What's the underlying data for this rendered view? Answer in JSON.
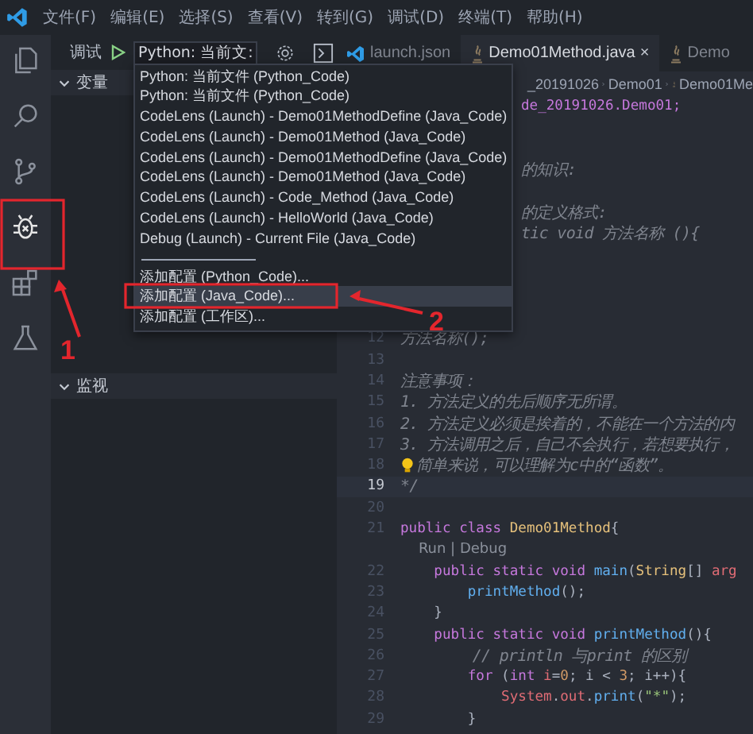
{
  "menu_bar": {
    "items": [
      "文件(F)",
      "编辑(E)",
      "选择(S)",
      "查看(V)",
      "转到(G)",
      "调试(D)",
      "终端(T)",
      "帮助(H)"
    ]
  },
  "activity_bar": {
    "items": [
      {
        "kind": "files",
        "selected": false
      },
      {
        "kind": "search",
        "selected": false
      },
      {
        "kind": "scm",
        "selected": false
      },
      {
        "kind": "debug",
        "selected": true
      },
      {
        "kind": "extensions",
        "selected": false
      },
      {
        "kind": "flask",
        "selected": false
      }
    ]
  },
  "sidebar": {
    "title": "调试",
    "config_select": "Python: 当前文:",
    "sections": [
      {
        "title": "变量",
        "expanded": true
      },
      {
        "title": "监视",
        "expanded": true
      }
    ]
  },
  "config_menu": {
    "items": [
      {
        "label": "Python: 当前文件 (Python_Code)",
        "selected": false
      },
      {
        "label": "Python: 当前文件 (Python_Code)",
        "selected": false
      },
      {
        "label": "CodeLens (Launch) - Demo01MethodDefine (Java_Code)",
        "selected": false
      },
      {
        "label": "CodeLens (Launch) - Demo01Method (Java_Code)",
        "selected": false
      },
      {
        "label": "CodeLens (Launch) - Demo01MethodDefine (Java_Code)",
        "selected": false
      },
      {
        "label": "CodeLens (Launch) - Demo01Method (Java_Code)",
        "selected": false
      },
      {
        "label": "CodeLens (Launch) - Code_Method (Java_Code)",
        "selected": false
      },
      {
        "label": "CodeLens (Launch) - HelloWorld (Java_Code)",
        "selected": false
      },
      {
        "label": "Debug (Launch) - Current File (Java_Code)",
        "selected": false
      }
    ],
    "actions": [
      {
        "label": "添加配置 (Python_Code)...",
        "selected": false
      },
      {
        "label": "添加配置 (Java_Code)...",
        "selected": true
      },
      {
        "label": "添加配置 (工作区)...",
        "selected": false
      }
    ]
  },
  "tabs": [
    {
      "label": "launch.json",
      "kind": "vscode",
      "selected": false
    },
    {
      "label": "Demo01Method.java",
      "kind": "java",
      "selected": true,
      "close": "×"
    },
    {
      "label": "Demo",
      "kind": "java",
      "selected": false
    }
  ],
  "breadcrumb": [
    "_20191026",
    "Demo01",
    "Demo01Me"
  ],
  "code": {
    "lines": [
      {
        "kind": "partial",
        "tokens": [
          {
            "text": "de_20191026.Demo01;",
            "kind": "package"
          }
        ]
      },
      {
        "kind": "covered"
      },
      {
        "kind": "covered"
      },
      {
        "kind": "partial",
        "tokens": [
          {
            "text": "的知识:",
            "kind": "comment"
          }
        ]
      },
      {
        "kind": "covered"
      },
      {
        "kind": "partial",
        "tokens": [
          {
            "text": "的定义格式:",
            "kind": "comment"
          }
        ]
      },
      {
        "kind": "partial",
        "tokens": [
          {
            "text": "tic void 方法名称 (){",
            "kind": "comment"
          }
        ]
      },
      {
        "kind": "covered"
      },
      {
        "kind": "covered"
      },
      {
        "kind": "covered"
      },
      {
        "kind": "covered"
      },
      {
        "kind": "code",
        "number": "12",
        "current": false,
        "tokens": [
          {
            "text": "方法名称();",
            "kind": "comment"
          }
        ]
      },
      {
        "kind": "code",
        "number": "13",
        "current": false
      },
      {
        "kind": "code",
        "number": "14",
        "current": false,
        "tokens": [
          {
            "text": "注意事项：",
            "kind": "comment"
          }
        ]
      },
      {
        "kind": "code",
        "number": "15",
        "current": false,
        "tokens": [
          {
            "text": "1. 方法定义的先后顺序无所谓。",
            "kind": "comment"
          }
        ]
      },
      {
        "kind": "code",
        "number": "16",
        "current": false,
        "tokens": [
          {
            "text": "2. 方法定义必须是挨着的，不能在一个方法的内",
            "kind": "comment"
          }
        ]
      },
      {
        "kind": "code",
        "number": "17",
        "current": false,
        "tokens": [
          {
            "text": "3. 方法调用之后，自己不会执行，若想要执行，",
            "kind": "comment"
          }
        ]
      },
      {
        "kind": "bulb",
        "number": "18",
        "current": false,
        "tokens": [
          {
            "text": "简单来说，可以理解为c中的“函数”。",
            "kind": "comment"
          }
        ]
      },
      {
        "kind": "code",
        "number": "19",
        "current": true,
        "tokens": [
          {
            "text": "*/",
            "kind": "comment"
          }
        ]
      },
      {
        "kind": "code",
        "number": "20",
        "current": false
      },
      {
        "kind": "code",
        "number": "21",
        "current": false,
        "tokens": [
          {
            "text": "public class ",
            "kind": "keyword"
          },
          {
            "text": "Demo01Method",
            "kind": "type"
          },
          {
            "text": "{",
            "kind": "plain"
          }
        ]
      },
      {
        "kind": "codelens",
        "tokens": [
          {
            "text": "    Run | Debug",
            "kind": "lens"
          }
        ]
      },
      {
        "kind": "code",
        "number": "22",
        "current": false,
        "tokens": [
          {
            "text": "    public static void ",
            "kind": "keyword"
          },
          {
            "text": "main",
            "kind": "func"
          },
          {
            "text": "(",
            "kind": "plain"
          },
          {
            "text": "String",
            "kind": "type"
          },
          {
            "text": "[] ",
            "kind": "plain"
          },
          {
            "text": "arg",
            "kind": "var"
          }
        ]
      },
      {
        "kind": "code",
        "number": "23",
        "current": false,
        "tokens": [
          {
            "text": "        printMethod",
            "kind": "func"
          },
          {
            "text": "();",
            "kind": "plain"
          }
        ]
      },
      {
        "kind": "code",
        "number": "24",
        "current": false,
        "tokens": [
          {
            "text": "    }",
            "kind": "plain"
          }
        ]
      },
      {
        "kind": "code",
        "number": "25",
        "current": false,
        "tokens": [
          {
            "text": "    public static void ",
            "kind": "keyword"
          },
          {
            "text": "printMethod",
            "kind": "func"
          },
          {
            "text": "(){",
            "kind": "plain"
          }
        ]
      },
      {
        "kind": "code",
        "number": "26",
        "current": false,
        "tokens": [
          {
            "text": "        // println 与print 的区别",
            "kind": "comment"
          }
        ]
      },
      {
        "kind": "code",
        "number": "27",
        "current": false,
        "tokens": [
          {
            "text": "        for",
            "kind": "keyword"
          },
          {
            "text": " (",
            "kind": "plain"
          },
          {
            "text": "int ",
            "kind": "keyword"
          },
          {
            "text": "i",
            "kind": "var"
          },
          {
            "text": "=",
            "kind": "plain"
          },
          {
            "text": "0",
            "kind": "number"
          },
          {
            "text": "; i < ",
            "kind": "plain"
          },
          {
            "text": "3",
            "kind": "number"
          },
          {
            "text": "; i++){",
            "kind": "plain"
          }
        ]
      },
      {
        "kind": "code",
        "number": "28",
        "current": false,
        "tokens": [
          {
            "text": "            System",
            "kind": "var"
          },
          {
            "text": ".",
            "kind": "plain"
          },
          {
            "text": "out",
            "kind": "var"
          },
          {
            "text": ".",
            "kind": "plain"
          },
          {
            "text": "print",
            "kind": "func"
          },
          {
            "text": "(",
            "kind": "plain"
          },
          {
            "text": "\"*\"",
            "kind": "string"
          },
          {
            "text": ");",
            "kind": "plain"
          }
        ]
      },
      {
        "kind": "code",
        "number": "29",
        "current": false,
        "tokens": [
          {
            "text": "        }",
            "kind": "plain"
          }
        ]
      }
    ]
  },
  "annotations": [
    {
      "label": "1"
    },
    {
      "label": "2"
    }
  ]
}
